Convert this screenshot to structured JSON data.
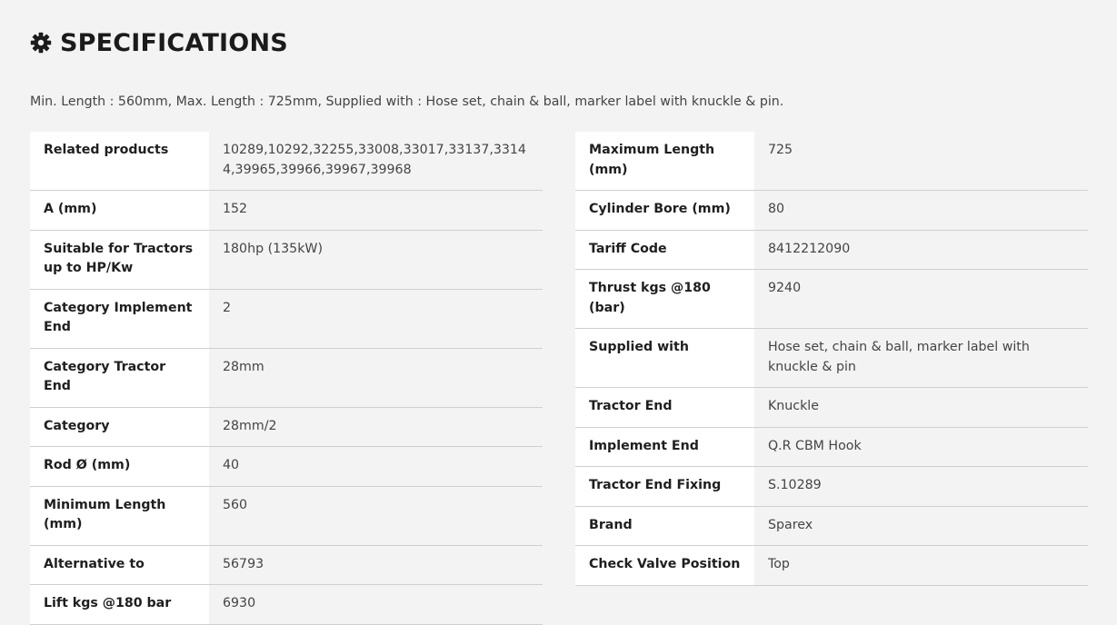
{
  "header": {
    "icon": "gear-icon",
    "title": "SPECIFICATIONS"
  },
  "summary": "Min. Length : 560mm, Max. Length : 725mm, Supplied with : Hose set, chain & ball, marker label with knuckle & pin.",
  "left_specs": [
    {
      "label": "Related products",
      "value": "10289,10292,32255,33008,33017,33137,33144,39965,39966,39967,39968"
    },
    {
      "label": "A (mm)",
      "value": "152"
    },
    {
      "label": "Suitable for Tractors up to HP/Kw",
      "value": "180hp (135kW)"
    },
    {
      "label": "Category Implement End",
      "value": "2"
    },
    {
      "label": "Category Tractor End",
      "value": "28mm"
    },
    {
      "label": "Category",
      "value": "28mm/2"
    },
    {
      "label": "Rod Ø (mm)",
      "value": "40"
    },
    {
      "label": "Minimum Length (mm)",
      "value": "560"
    },
    {
      "label": "Alternative to",
      "value": "56793"
    },
    {
      "label": "Lift kgs @180 bar",
      "value": "6930"
    }
  ],
  "right_specs": [
    {
      "label": "Maximum Length (mm)",
      "value": "725"
    },
    {
      "label": "Cylinder Bore (mm)",
      "value": "80"
    },
    {
      "label": "Tariff Code",
      "value": "8412212090"
    },
    {
      "label": "Thrust kgs @180 (bar)",
      "value": "9240"
    },
    {
      "label": "Supplied with",
      "value": "Hose set, chain & ball, marker label with knuckle & pin"
    },
    {
      "label": "Tractor End",
      "value": "Knuckle"
    },
    {
      "label": "Implement End",
      "value": "Q.R CBM Hook"
    },
    {
      "label": "Tractor End Fixing",
      "value": "S.10289"
    },
    {
      "label": "Brand",
      "value": "Sparex"
    },
    {
      "label": "Check Valve Position",
      "value": "Top"
    }
  ]
}
